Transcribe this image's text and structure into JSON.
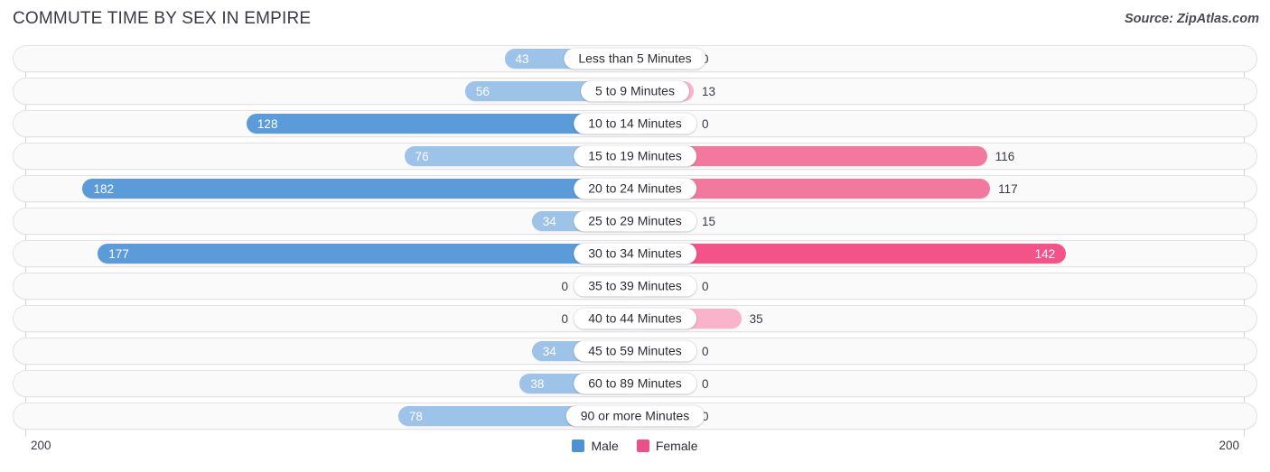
{
  "header": {
    "title": "COMMUTE TIME BY SEX IN EMPIRE",
    "source": "Source: ZipAtlas.com"
  },
  "axis": {
    "left_label": "200",
    "right_label": "200",
    "max": 200
  },
  "legend": {
    "items": [
      {
        "label": "Male",
        "color": "#4d92d9"
      },
      {
        "label": "Female",
        "color": "#ef4f89"
      }
    ]
  },
  "colors": {
    "male_light": "#9dc3e8",
    "male_dark": "#5b9bd9",
    "female_light": "#f9b3cb",
    "female_mid": "#f2789f",
    "female_dark": "#f4538a"
  },
  "chart_data": {
    "type": "bar",
    "title": "COMMUTE TIME BY SEX IN EMPIRE",
    "xlabel": "",
    "ylabel": "",
    "orientation": "horizontal-diverging",
    "xlim": [
      -200,
      200
    ],
    "grid": false,
    "legend_position": "bottom-center",
    "categories": [
      "Less than 5 Minutes",
      "5 to 9 Minutes",
      "10 to 14 Minutes",
      "15 to 19 Minutes",
      "20 to 24 Minutes",
      "25 to 29 Minutes",
      "30 to 34 Minutes",
      "35 to 39 Minutes",
      "40 to 44 Minutes",
      "45 to 59 Minutes",
      "60 to 89 Minutes",
      "90 or more Minutes"
    ],
    "series": [
      {
        "name": "Male",
        "values": [
          43,
          56,
          128,
          76,
          182,
          34,
          177,
          0,
          0,
          34,
          38,
          78
        ]
      },
      {
        "name": "Female",
        "values": [
          0,
          13,
          0,
          116,
          117,
          15,
          142,
          0,
          35,
          0,
          0,
          0
        ]
      }
    ]
  },
  "rows": [
    {
      "category": "Less than 5 Minutes",
      "male": "43",
      "female": "0",
      "male_value": 43,
      "female_value": 0
    },
    {
      "category": "5 to 9 Minutes",
      "male": "56",
      "female": "13",
      "male_value": 56,
      "female_value": 13
    },
    {
      "category": "10 to 14 Minutes",
      "male": "128",
      "female": "0",
      "male_value": 128,
      "female_value": 0
    },
    {
      "category": "15 to 19 Minutes",
      "male": "76",
      "female": "116",
      "male_value": 76,
      "female_value": 116
    },
    {
      "category": "20 to 24 Minutes",
      "male": "182",
      "female": "117",
      "male_value": 182,
      "female_value": 117
    },
    {
      "category": "25 to 29 Minutes",
      "male": "34",
      "female": "15",
      "male_value": 34,
      "female_value": 15
    },
    {
      "category": "30 to 34 Minutes",
      "male": "177",
      "female": "142",
      "male_value": 177,
      "female_value": 142
    },
    {
      "category": "35 to 39 Minutes",
      "male": "0",
      "female": "0",
      "male_value": 0,
      "female_value": 0
    },
    {
      "category": "40 to 44 Minutes",
      "male": "0",
      "female": "35",
      "male_value": 0,
      "female_value": 35
    },
    {
      "category": "45 to 59 Minutes",
      "male": "34",
      "female": "0",
      "male_value": 34,
      "female_value": 0
    },
    {
      "category": "60 to 89 Minutes",
      "male": "38",
      "female": "0",
      "male_value": 38,
      "female_value": 0
    },
    {
      "category": "90 or more Minutes",
      "male": "78",
      "female": "0",
      "male_value": 78,
      "female_value": 0
    }
  ]
}
